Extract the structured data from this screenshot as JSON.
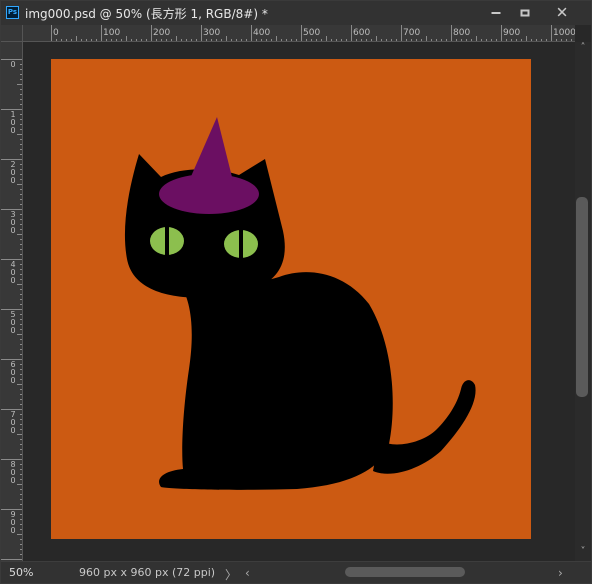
{
  "app": {
    "icon_label": "Ps"
  },
  "document": {
    "tab_title": "img000.psd @ 50% (長方形 1, RGB/8#) *",
    "zoom": "50%",
    "info": "960 px x 960 px (72 ppi)"
  },
  "window_controls": {
    "close_glyph": "✕"
  },
  "rulers": {
    "horizontal_ticks": [
      "0",
      "100",
      "200",
      "300",
      "400",
      "500",
      "600",
      "700",
      "800",
      "900",
      "1000"
    ],
    "vertical_ticks": [
      "0",
      "100",
      "200",
      "300",
      "400",
      "500",
      "600",
      "700",
      "800",
      "900"
    ]
  },
  "scroll_glyphs": {
    "up": "˄",
    "down": "˅",
    "status_right_chevron": "〉",
    "left": "‹",
    "right": "›"
  },
  "colors": {
    "canvas_background": "#cc5a12",
    "cat": "#000000",
    "hat": "#6b0f62",
    "eyes": "#8cbf4e"
  },
  "artwork_icons": [
    "black-cat",
    "witch-hat"
  ]
}
